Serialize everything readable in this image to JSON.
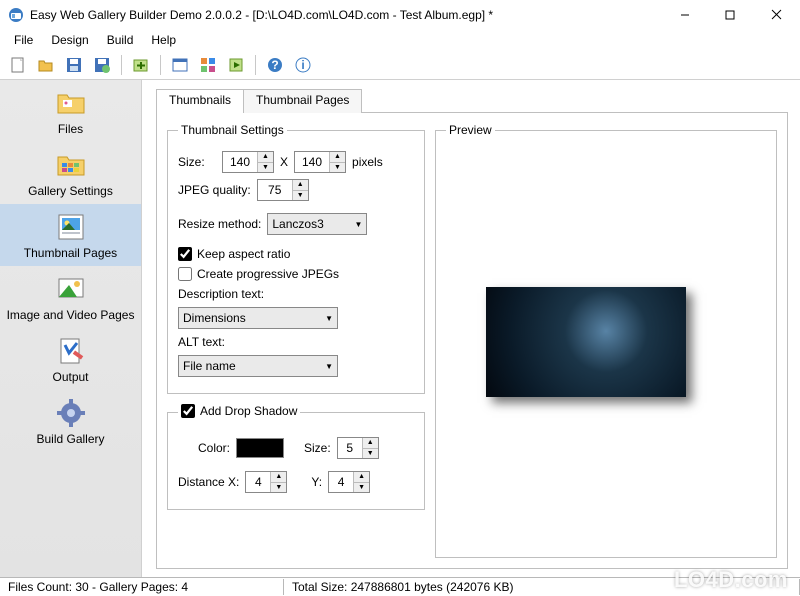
{
  "window": {
    "title": "Easy Web Gallery Builder Demo 2.0.0.2 - [D:\\LO4D.com\\LO4D.com - Test Album.egp] *"
  },
  "menu": {
    "file": "File",
    "design": "Design",
    "build": "Build",
    "help": "Help"
  },
  "sidebar": {
    "items": [
      {
        "label": "Files"
      },
      {
        "label": "Gallery Settings"
      },
      {
        "label": "Thumbnail Pages"
      },
      {
        "label": "Image and Video Pages"
      },
      {
        "label": "Output"
      },
      {
        "label": "Build Gallery"
      }
    ]
  },
  "tabs": {
    "thumbnails": "Thumbnails",
    "thumbnail_pages": "Thumbnail Pages"
  },
  "thumb": {
    "legend": "Thumbnail Settings",
    "size_label": "Size:",
    "size_w": "140",
    "x_text": "X",
    "size_h": "140",
    "px_text": "pixels",
    "jpeg_label": "JPEG quality:",
    "jpeg_val": "75",
    "resize_label": "Resize method:",
    "resize_val": "Lanczos3",
    "keep_aspect": "Keep aspect ratio",
    "progressive": "Create progressive JPEGs",
    "desc_label": "Description text:",
    "desc_val": "Dimensions",
    "alt_label": "ALT text:",
    "alt_val": "File name"
  },
  "shadow": {
    "add": "Add Drop Shadow",
    "color_label": "Color:",
    "size_label": "Size:",
    "size_val": "5",
    "dist_label": "Distance   X:",
    "dist_x": "4",
    "y_label": "Y:",
    "dist_y": "4"
  },
  "preview": {
    "legend": "Preview"
  },
  "status": {
    "left": "Files Count: 30 - Gallery Pages: 4",
    "right": "Total Size: 247886801 bytes (242076 KB)"
  },
  "watermark": "LO4D.com"
}
